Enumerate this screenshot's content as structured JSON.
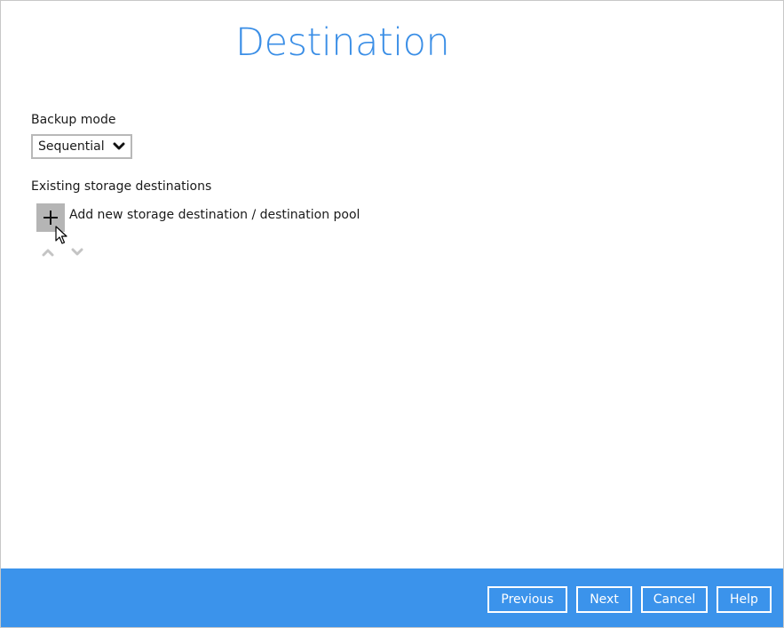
{
  "page": {
    "title": "Destination"
  },
  "backup_mode": {
    "label": "Backup mode",
    "selected": "Sequential"
  },
  "destinations": {
    "label": "Existing storage destinations",
    "add_label": "Add new storage destination / destination pool"
  },
  "footer": {
    "previous": "Previous",
    "next": "Next",
    "cancel": "Cancel",
    "help": "Help"
  },
  "icons": {
    "select_chevron": "chevron-down-icon",
    "add": "plus-icon",
    "move_up": "chevron-up-icon",
    "move_down": "chevron-down-icon",
    "cursor": "mouse-pointer-icon"
  },
  "colors": {
    "accent": "#3a8ee6",
    "footer_bg": "#3b93eb",
    "add_button_bg": "#b5b5b5",
    "disabled_arrow": "#c4c4c4"
  }
}
